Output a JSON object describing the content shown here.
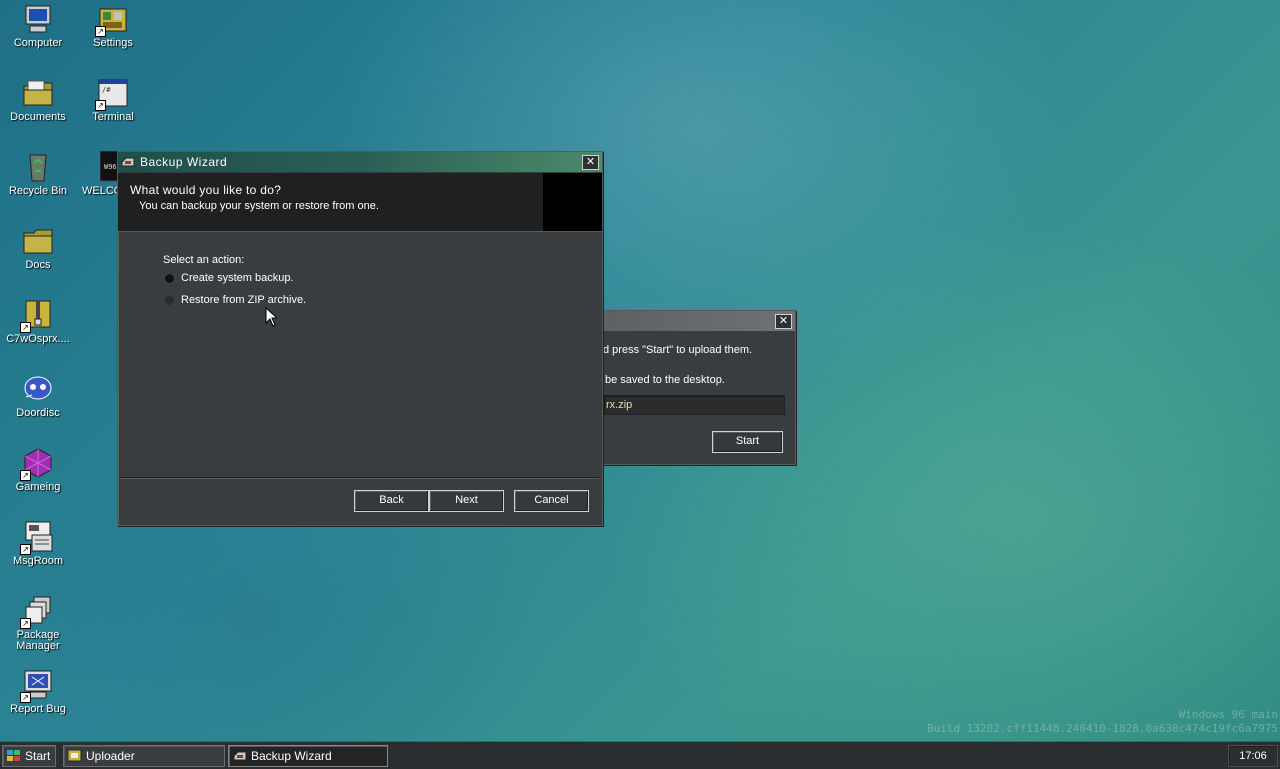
{
  "desktop": {
    "icons": [
      {
        "label": "Computer",
        "icon": "computer-icon"
      },
      {
        "label": "Settings",
        "icon": "settings-icon"
      },
      {
        "label": "Documents",
        "icon": "documents-folder-icon"
      },
      {
        "label": "Terminal",
        "icon": "terminal-icon"
      },
      {
        "label": "Recycle Bin",
        "icon": "recycle-bin-icon"
      },
      {
        "label": "WELCO",
        "icon": "welcome-icon"
      },
      {
        "label": "Docs",
        "icon": "docs-folder-icon"
      },
      {
        "label": "C7wOsprx....",
        "icon": "zip-file-icon"
      },
      {
        "label": "Doordisc",
        "icon": "doordisc-icon"
      },
      {
        "label": "Gameing",
        "icon": "gameing-icon"
      },
      {
        "label": "MsgRoom",
        "icon": "msgroom-icon"
      },
      {
        "label": "Package Manager",
        "icon": "package-manager-icon"
      },
      {
        "label": "Report Bug",
        "icon": "report-bug-icon"
      }
    ]
  },
  "uploader_window": {
    "text_line1": "d press \"Start\" to upload them.",
    "text_line2": "be saved to the desktop.",
    "filename_value": "rx.zip",
    "start_label": "Start",
    "close_symbol": "✕"
  },
  "wizard": {
    "title": "Backup Wizard",
    "close_symbol": "✕",
    "header_title": "What would you like to do?",
    "header_subtitle": "You can backup your system or restore from one.",
    "select_label": "Select an action:",
    "options": [
      "Create system backup.",
      "Restore from ZIP archive."
    ],
    "back_label": "Back",
    "next_label": "Next",
    "cancel_label": "Cancel"
  },
  "watermark": {
    "line1": "Windows 96 main",
    "line2": "Build 13202.cff11448.240410-1828.0a630c474c19fc6a7975"
  },
  "taskbar": {
    "start_label": "Start",
    "tasks": [
      "Uploader",
      "Backup Wizard"
    ],
    "clock": "17:06"
  },
  "colors": {
    "window_bg": "#3a3d3f",
    "titlebar_gradient_start": "#1f4f4a",
    "titlebar_gradient_end": "#4c8a6a",
    "taskbar_bg": "#2b2e30"
  }
}
